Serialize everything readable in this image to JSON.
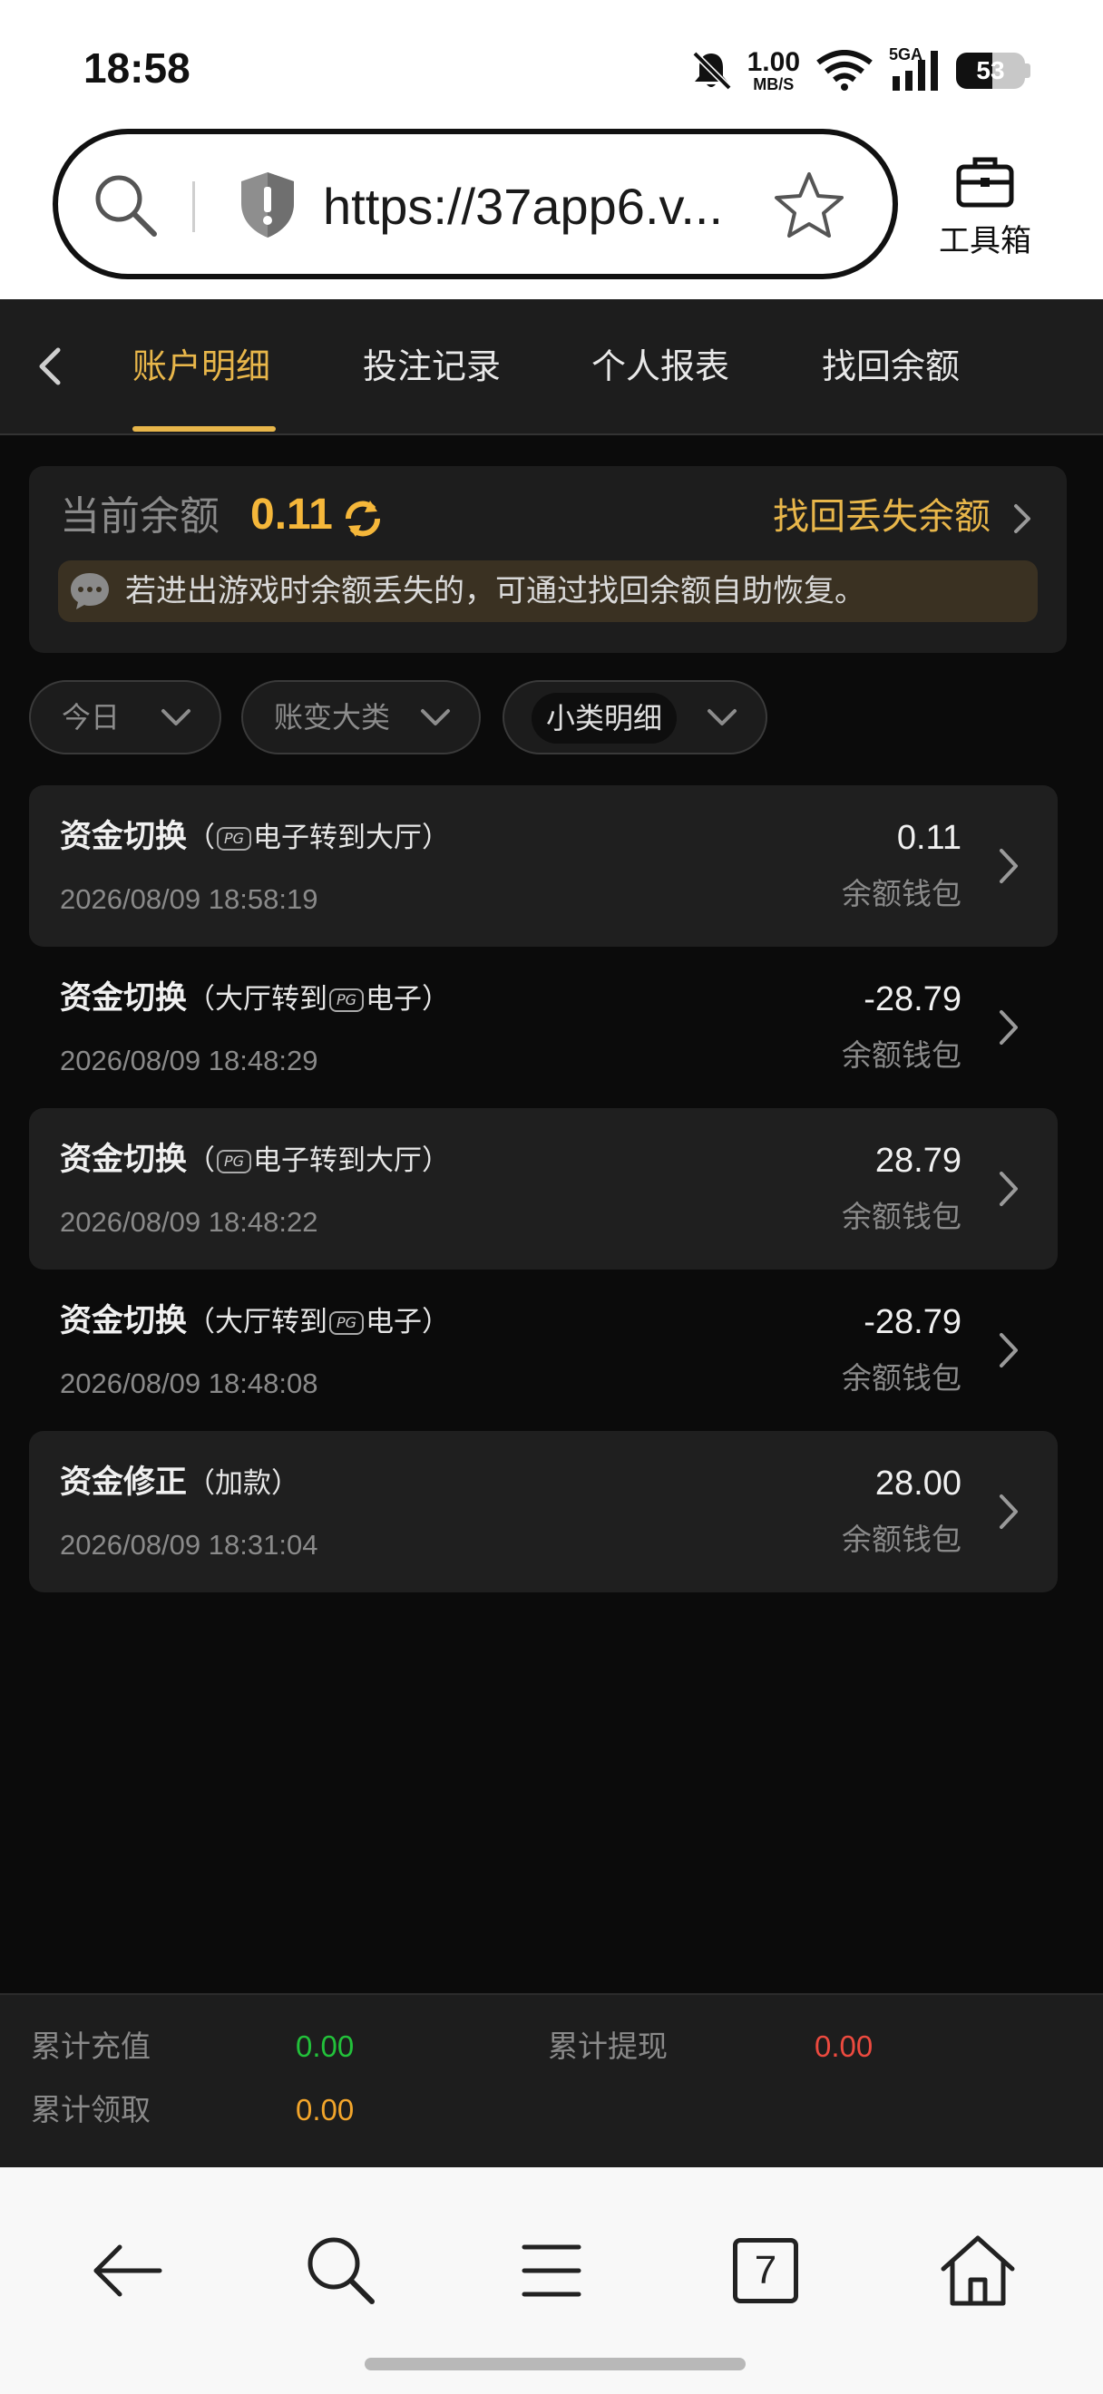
{
  "status_bar": {
    "time": "18:58",
    "net_speed_value": "1.00",
    "net_speed_unit": "MB/S",
    "network_gen": "5GA",
    "battery": "53",
    "battery_level": 0.53
  },
  "browser": {
    "url": "https://37app6.v...",
    "toolbox_label": "工具箱"
  },
  "tabs": [
    {
      "label": "账户明细",
      "active": true
    },
    {
      "label": "投注记录",
      "active": false
    },
    {
      "label": "个人报表",
      "active": false
    },
    {
      "label": "找回余额",
      "active": false
    }
  ],
  "balance": {
    "label": "当前余额",
    "value": "0.11",
    "recover_link": "找回丢失余额",
    "notice": "若进出游戏时余额丢失的，可通过找回余额自助恢复。"
  },
  "filters": [
    {
      "label": "今日",
      "selected": false
    },
    {
      "label": "账变大类",
      "selected": false
    },
    {
      "label": "小类明细",
      "selected": true
    }
  ],
  "transactions": [
    {
      "type": "资金切换",
      "pre": "（",
      "logo": "PG",
      "post": "电子转到大厅）",
      "time": "2026/08/09 18:58:19",
      "amount": "0.11",
      "wallet": "余额钱包"
    },
    {
      "type": "资金切换",
      "pre": "（大厅转到",
      "logo": "PG",
      "post": "电子）",
      "time": "2026/08/09 18:48:29",
      "amount": "-28.79",
      "wallet": "余额钱包"
    },
    {
      "type": "资金切换",
      "pre": "（",
      "logo": "PG",
      "post": "电子转到大厅）",
      "time": "2026/08/09 18:48:22",
      "amount": "28.79",
      "wallet": "余额钱包"
    },
    {
      "type": "资金切换",
      "pre": "（大厅转到",
      "logo": "PG",
      "post": "电子）",
      "time": "2026/08/09 18:48:08",
      "amount": "-28.79",
      "wallet": "余额钱包"
    },
    {
      "type": "资金修正",
      "pre": "（加款）",
      "logo": "",
      "post": "",
      "time": "2026/08/09 18:31:04",
      "amount": "28.00",
      "wallet": "余额钱包"
    }
  ],
  "summary": {
    "total_recharge_label": "累计充值",
    "total_recharge": "0.00",
    "total_withdraw_label": "累计提现",
    "total_withdraw": "0.00",
    "total_claim_label": "累计领取",
    "total_claim": "0.00"
  },
  "bottom_nav": {
    "tab_count": "7"
  },
  "colors": {
    "accent_gold": "#e8b64a",
    "balance_orange": "#f5b73a",
    "green": "#22c13a",
    "red": "#ec4a3f",
    "orange": "#f2a52b"
  }
}
